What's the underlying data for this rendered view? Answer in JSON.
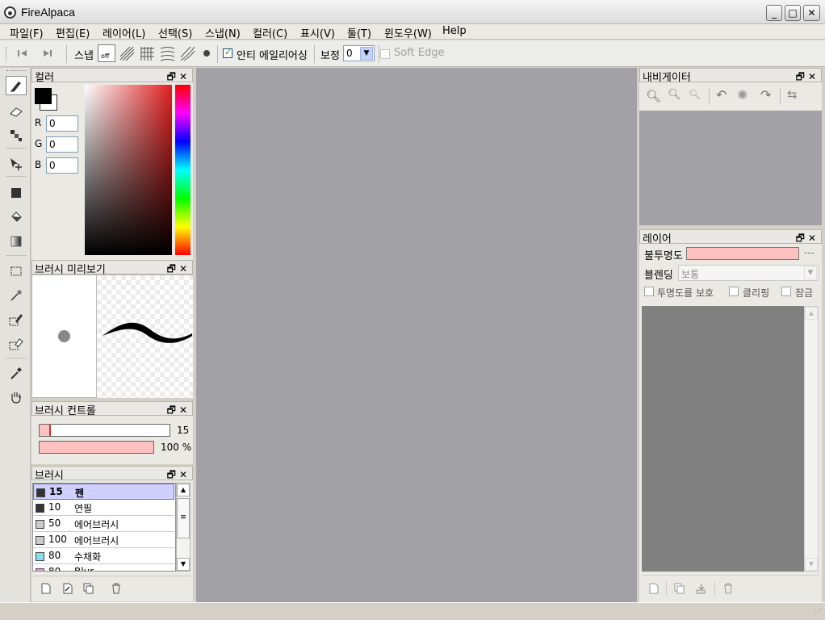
{
  "window": {
    "title": "FireAlpaca"
  },
  "menu": [
    "파일(F)",
    "편집(E)",
    "레이어(L)",
    "선택(S)",
    "스냅(N)",
    "컬러(C)",
    "표시(V)",
    "툴(T)",
    "윈도우(W)",
    "Help"
  ],
  "toolbar": {
    "snap_label": "스냅",
    "snap_off_label": "off",
    "antialias_label": "안티 에일리어싱",
    "antialias_checked": true,
    "correction_label": "보정",
    "correction_value": "0",
    "soft_edge_label": "Soft Edge",
    "soft_edge_checked": false
  },
  "color_panel": {
    "title": "컬러",
    "r_label": "R",
    "r_value": "0",
    "g_label": "G",
    "g_value": "0",
    "b_label": "B",
    "b_value": "0",
    "primary_color": "#000000",
    "secondary_color": "#ffffff"
  },
  "brush_preview": {
    "title": "브러시 미리보기"
  },
  "brush_control": {
    "title": "브러시 컨트롤",
    "size_value": "15",
    "opacity_value": "100 %",
    "size_fraction": 0.09,
    "opacity_fraction": 1.0
  },
  "brush_panel": {
    "title": "브러시",
    "items": [
      {
        "size": "15",
        "name": "펜",
        "color": "#333333",
        "selected": true
      },
      {
        "size": "10",
        "name": "연필",
        "color": "#333333",
        "selected": false
      },
      {
        "size": "50",
        "name": "에어브러시",
        "color": "#cccccc",
        "selected": false
      },
      {
        "size": "100",
        "name": "에어브러시",
        "color": "#cccccc",
        "selected": false
      },
      {
        "size": "80",
        "name": "수채화",
        "color": "#88ddee",
        "selected": false
      },
      {
        "size": "80",
        "name": "Blur",
        "color": "#ee99dd",
        "selected": false
      }
    ]
  },
  "navigator": {
    "title": "내비게이터"
  },
  "layer_panel": {
    "title": "레이어",
    "opacity_label": "불투명도",
    "opacity_value": "---",
    "blend_label": "블렌딩",
    "blend_value": "보통",
    "protect_label": "투명도를 보호",
    "clipping_label": "클리핑",
    "lock_label": "잠금"
  },
  "colors": {
    "accent_pink": "#ffc0c0",
    "canvas_gray": "#a2a1a6",
    "selection_blue": "#d0d0ff"
  }
}
